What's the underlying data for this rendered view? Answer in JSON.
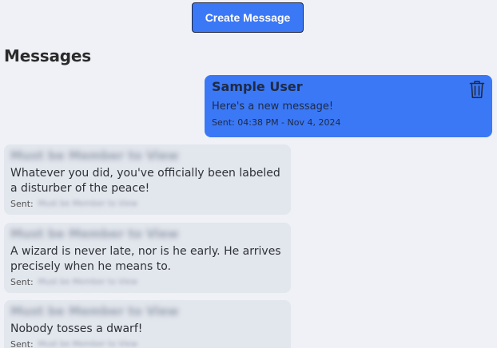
{
  "create_button": {
    "label": "Create Message"
  },
  "heading": "Messages",
  "own_message": {
    "author": "Sample User",
    "text": "Here's a new message!",
    "sent": "Sent: 04:38 PM - Nov 4, 2024",
    "delete_icon": "trash-icon",
    "color": "#3b78f5"
  },
  "other_messages": [
    {
      "author": "Must be Member to View",
      "text": "Whatever you did, you've officially been labeled a disturber of the peace!",
      "sent_label": "Sent:",
      "sent_value": "Must be Member to View"
    },
    {
      "author": "Must be Member to View",
      "text": "A wizard is never late, nor is he early. He arrives precisely when he means to.",
      "sent_label": "Sent:",
      "sent_value": "Must be Member to View"
    },
    {
      "author": "Must be Member to View",
      "text": "Nobody tosses a dwarf!",
      "sent_label": "Sent:",
      "sent_value": "Must be Member to View"
    }
  ],
  "colors": {
    "background": "#eff1f6",
    "accent": "#3b78f5",
    "bubble_other": "#e2e6ed"
  }
}
